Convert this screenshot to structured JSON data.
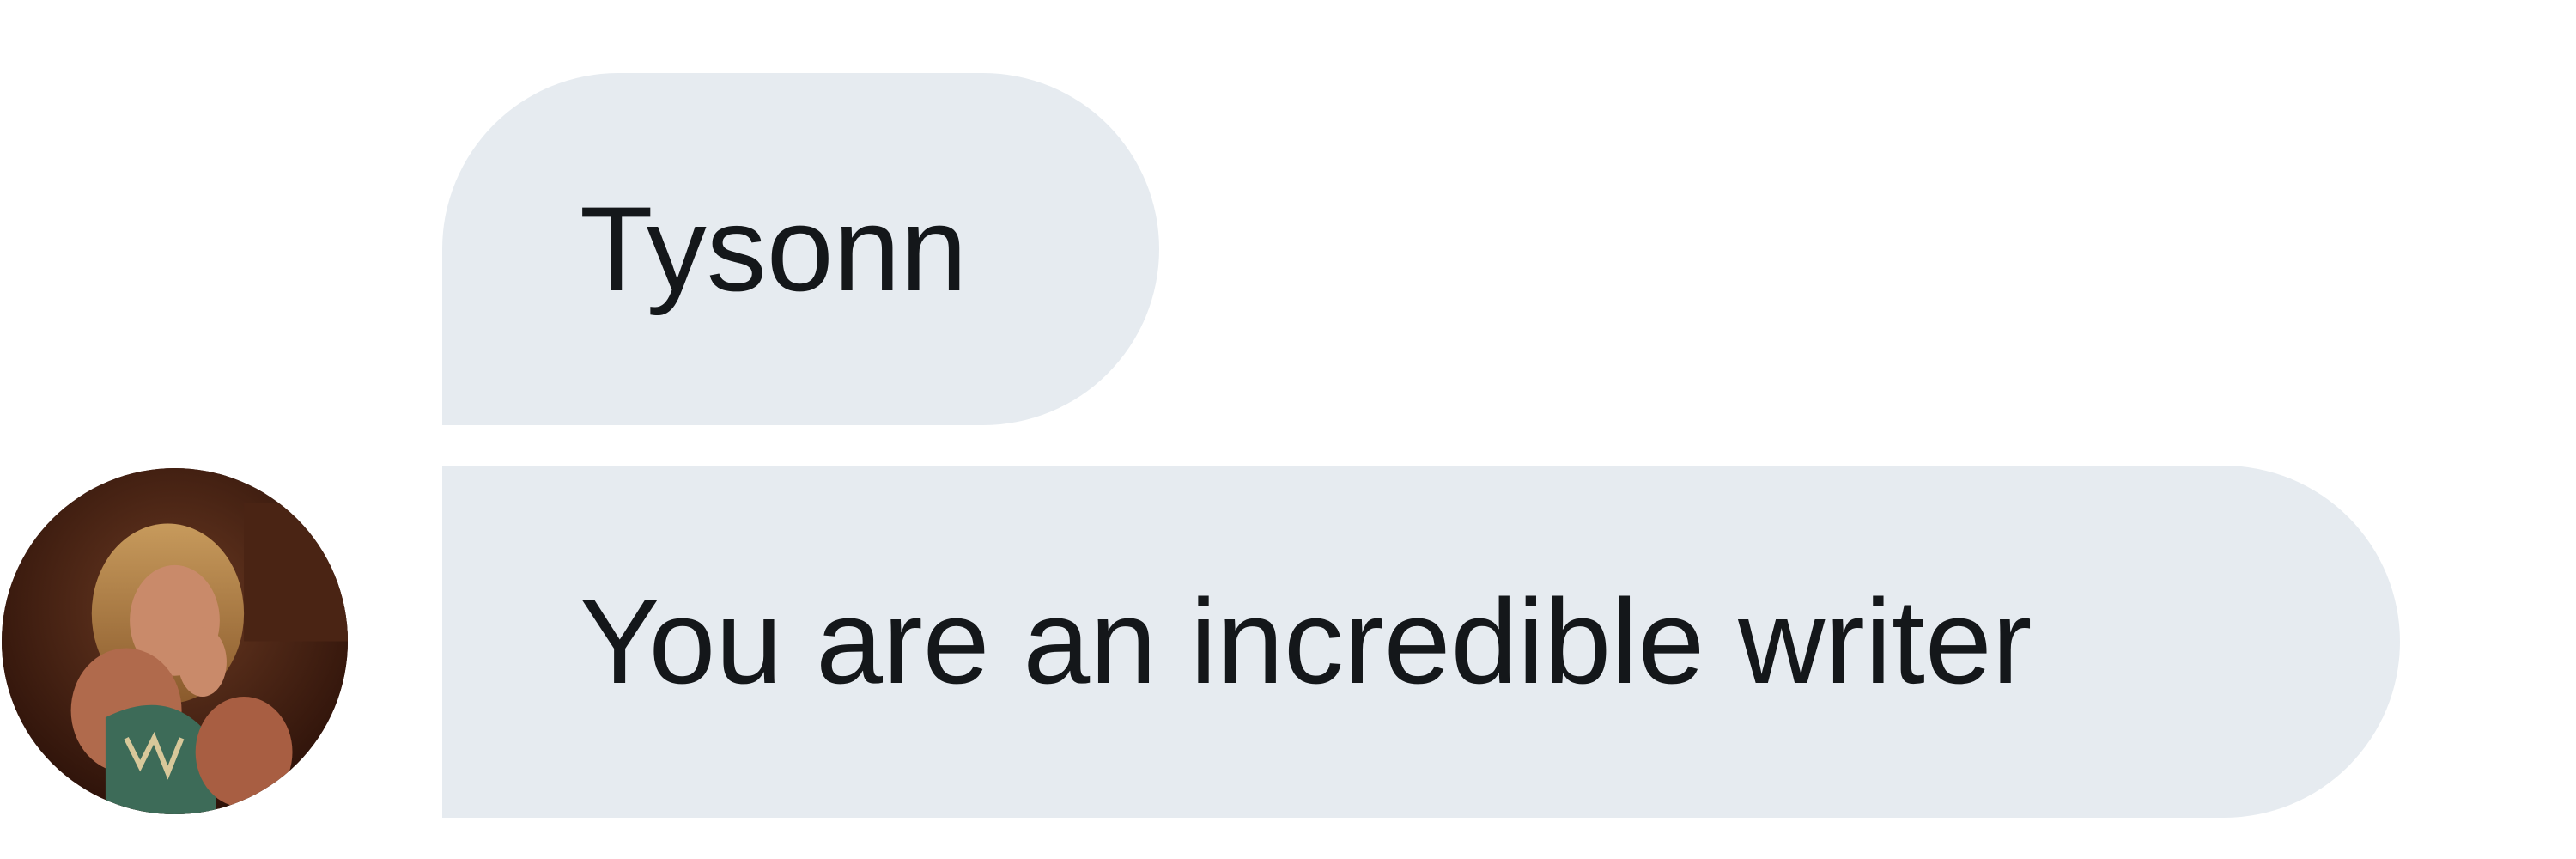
{
  "conversation": {
    "messages": [
      {
        "text": "Tysonn"
      },
      {
        "text": "You are an incredible writer"
      }
    ],
    "avatar": {
      "icon": "profile-photo-avatar"
    }
  },
  "colors": {
    "bubble_bg": "#e6ebf0",
    "text": "#14171a",
    "page_bg": "#ffffff"
  }
}
